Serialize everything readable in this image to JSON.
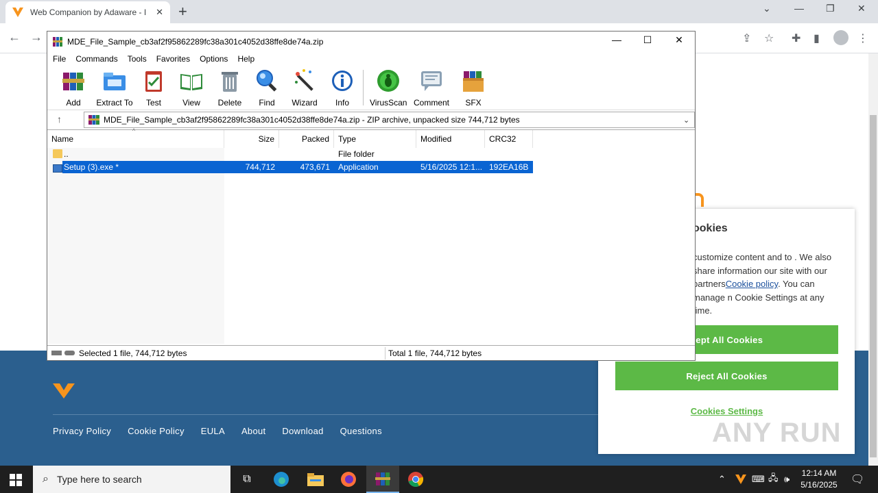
{
  "browser": {
    "tab_title": "Web Companion by Adaware - I",
    "tab_close": "✕",
    "new_tab": "+",
    "nav_back": "←",
    "nav_forward": "→",
    "brand_color": "#f7941d"
  },
  "page": {
    "footer_links": [
      "Privacy Policy",
      "Cookie Policy",
      "EULA",
      "About",
      "Download",
      "Questions"
    ],
    "footer_color": "#2b5f8e"
  },
  "cookie": {
    "title": "ookies",
    "text_before_link": "customize content and to . We also share information our site with our partners",
    "link": "Cookie policy",
    "text_after_link": ". You can manage n Cookie Settings at any time.",
    "accept": "cept All Cookies",
    "reject": "Reject All Cookies",
    "settings": "Cookies Settings",
    "button_color": "#5cb946"
  },
  "watermark": "ANY RUN",
  "winrar": {
    "title": "MDE_File_Sample_cb3af2f95862289fc38a301c4052d38ffe8de74a.zip",
    "menu": [
      "File",
      "Commands",
      "Tools",
      "Favorites",
      "Options",
      "Help"
    ],
    "toolbar": {
      "add": "Add",
      "extract": "Extract To",
      "test": "Test",
      "view": "View",
      "delete": "Delete",
      "find": "Find",
      "wizard": "Wizard",
      "info": "Info",
      "virusscan": "VirusScan",
      "comment": "Comment",
      "sfx": "SFX"
    },
    "address": "MDE_File_Sample_cb3af2f95862289fc38a301c4052d38ffe8de74a.zip - ZIP archive, unpacked size 744,712 bytes",
    "columns": {
      "name": "Name",
      "size": "Size",
      "packed": "Packed",
      "type": "Type",
      "modified": "Modified",
      "crc": "CRC32"
    },
    "rows": [
      {
        "name": "..",
        "size": "",
        "packed": "",
        "type": "File folder",
        "modified": "",
        "crc": ""
      },
      {
        "name": "Setup (3).exe *",
        "size": "744,712",
        "packed": "473,671",
        "type": "Application",
        "modified": "5/16/2025 12:1...",
        "crc": "192EA16B"
      }
    ],
    "status_left": "Selected 1 file, 744,712 bytes",
    "status_right": "Total 1 file, 744,712 bytes"
  },
  "taskbar": {
    "search_placeholder": "Type here to search",
    "time": "12:14 AM",
    "date": "5/16/2025"
  }
}
